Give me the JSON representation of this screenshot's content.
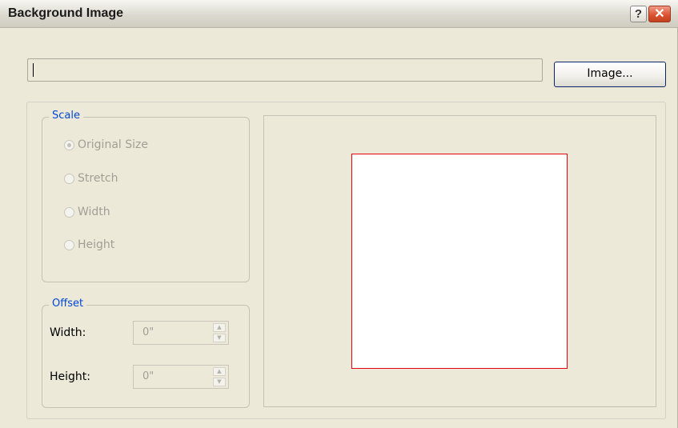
{
  "window": {
    "title": "Background Image",
    "help_label": "?",
    "close_label": "✕"
  },
  "path": {
    "value": ""
  },
  "image_button": {
    "label": "Image..."
  },
  "scale": {
    "legend": "Scale",
    "options": [
      {
        "label": "Original Size",
        "checked": true
      },
      {
        "label": "Stretch",
        "checked": false
      },
      {
        "label": "Width",
        "checked": false
      },
      {
        "label": "Height",
        "checked": false
      }
    ]
  },
  "offset": {
    "legend": "Offset",
    "width_label": "Width:",
    "width_value": "0\"",
    "height_label": "Height:",
    "height_value": "0\""
  },
  "colors": {
    "accent": "#0046d5",
    "preview_border": "#e6000f",
    "dialog_bg": "#ECE9D8"
  }
}
